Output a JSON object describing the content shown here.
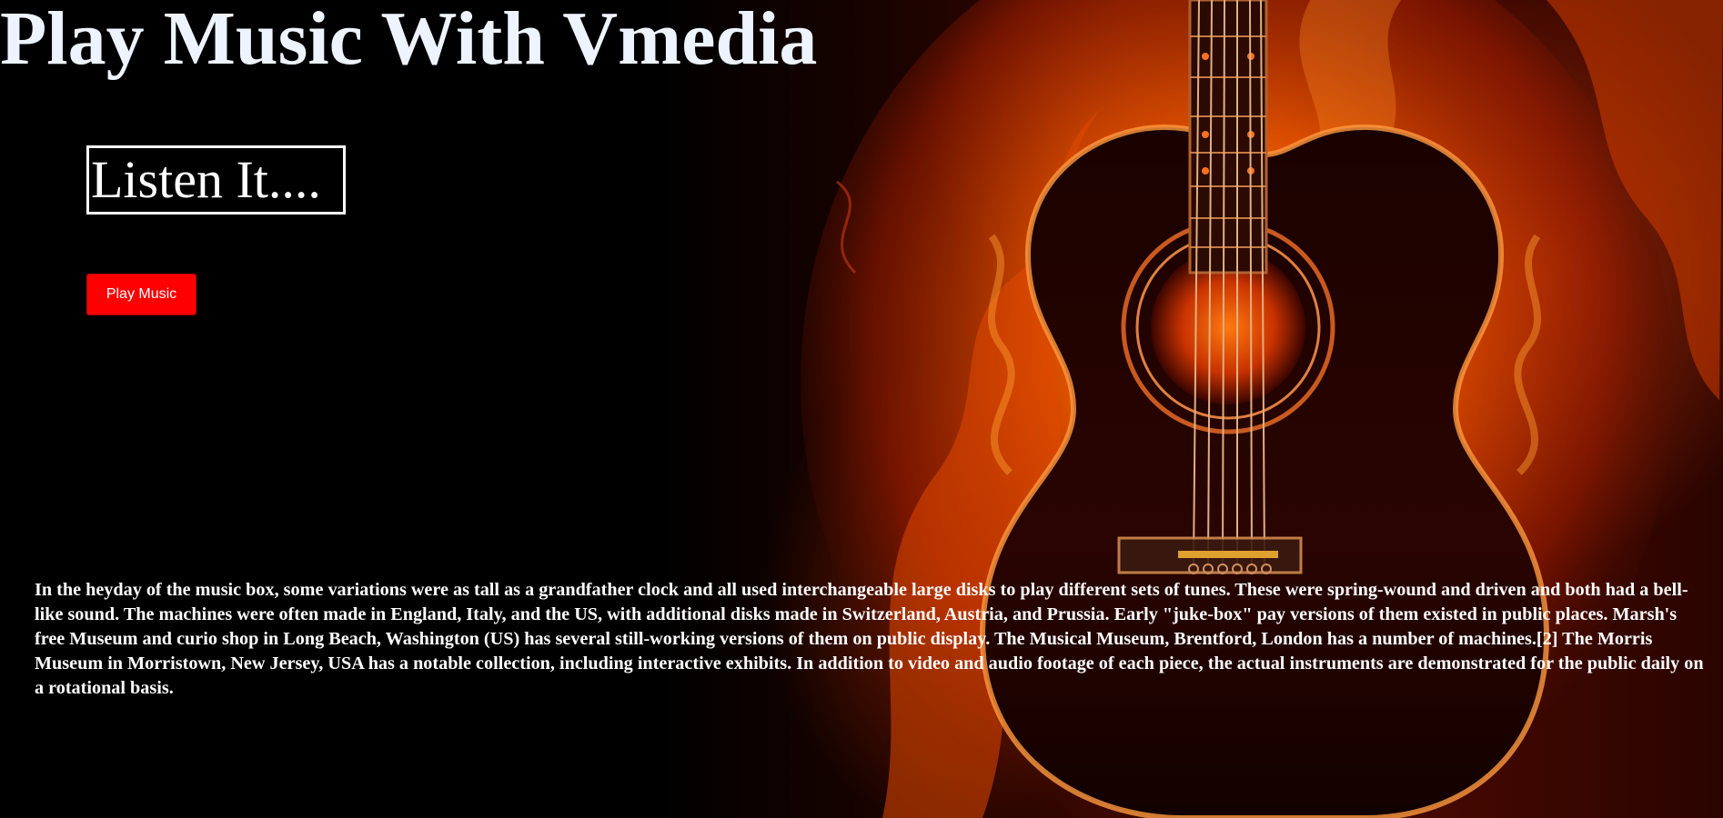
{
  "header": {
    "title": "Play Music With Vmedia"
  },
  "main": {
    "listen_label": "Listen It....",
    "play_button_label": "Play Music",
    "description": "In the heyday of the music box, some variations were as tall as a grandfather clock and all used interchangeable large disks to play different sets of tunes. These were spring-wound and driven and both had a bell-like sound. The machines were often made in England, Italy, and the US, with additional disks made in Switzerland, Austria, and Prussia. Early \"juke-box\" pay versions of them existed in public places. Marsh's free Museum and curio shop in Long Beach, Washington (US) has several still-working versions of them on public display. The Musical Museum, Brentford, London has a number of machines.[2] The Morris Museum in Morristown, New Jersey, USA has a notable collection, including interactive exhibits. In addition to video and audio footage of each piece, the actual instruments are demonstrated for the public daily on a rotational basis."
  },
  "background": {
    "image": "flaming-acoustic-guitar",
    "colors": {
      "base": "#000000",
      "flame_dark": "#8a1400",
      "flame_mid": "#e04a00",
      "flame_light": "#ffb030",
      "guitar_strings": "#d9a070"
    }
  },
  "colors": {
    "title_text": "#eef4ff",
    "button_bg": "#ff0000",
    "text": "#ffffff"
  }
}
